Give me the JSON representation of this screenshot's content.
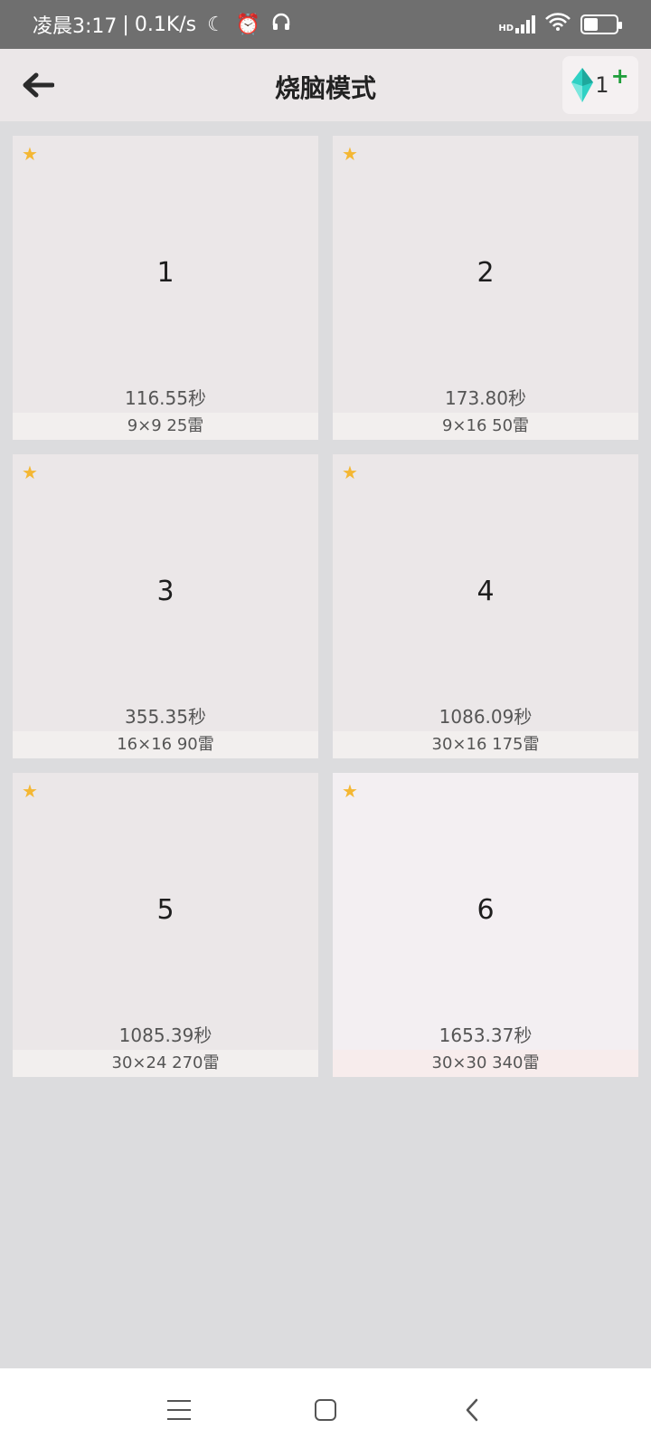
{
  "status_bar": {
    "time": "凌晨3:17",
    "speed": "0.1K/s",
    "network_badge": "HD",
    "icons": [
      "moon-icon",
      "alarm-icon",
      "headphones-icon",
      "signal-icon",
      "wifi-icon",
      "battery-icon"
    ]
  },
  "app_bar": {
    "title": "烧脑模式",
    "gem_count": "1",
    "plus": "+"
  },
  "levels": [
    {
      "number": "1",
      "best_time": "116.55秒",
      "spec": "9×9  25雷"
    },
    {
      "number": "2",
      "best_time": "173.80秒",
      "spec": "9×16  50雷"
    },
    {
      "number": "3",
      "best_time": "355.35秒",
      "spec": "16×16  90雷"
    },
    {
      "number": "4",
      "best_time": "1086.09秒",
      "spec": "30×16  175雷"
    },
    {
      "number": "5",
      "best_time": "1085.39秒",
      "spec": "30×24  270雷"
    },
    {
      "number": "6",
      "best_time": "1653.37秒",
      "spec": "30×30  340雷"
    }
  ],
  "colors": {
    "star": "#f4b733",
    "gem": "#2fd1c4",
    "plus": "#1e9e3a"
  }
}
